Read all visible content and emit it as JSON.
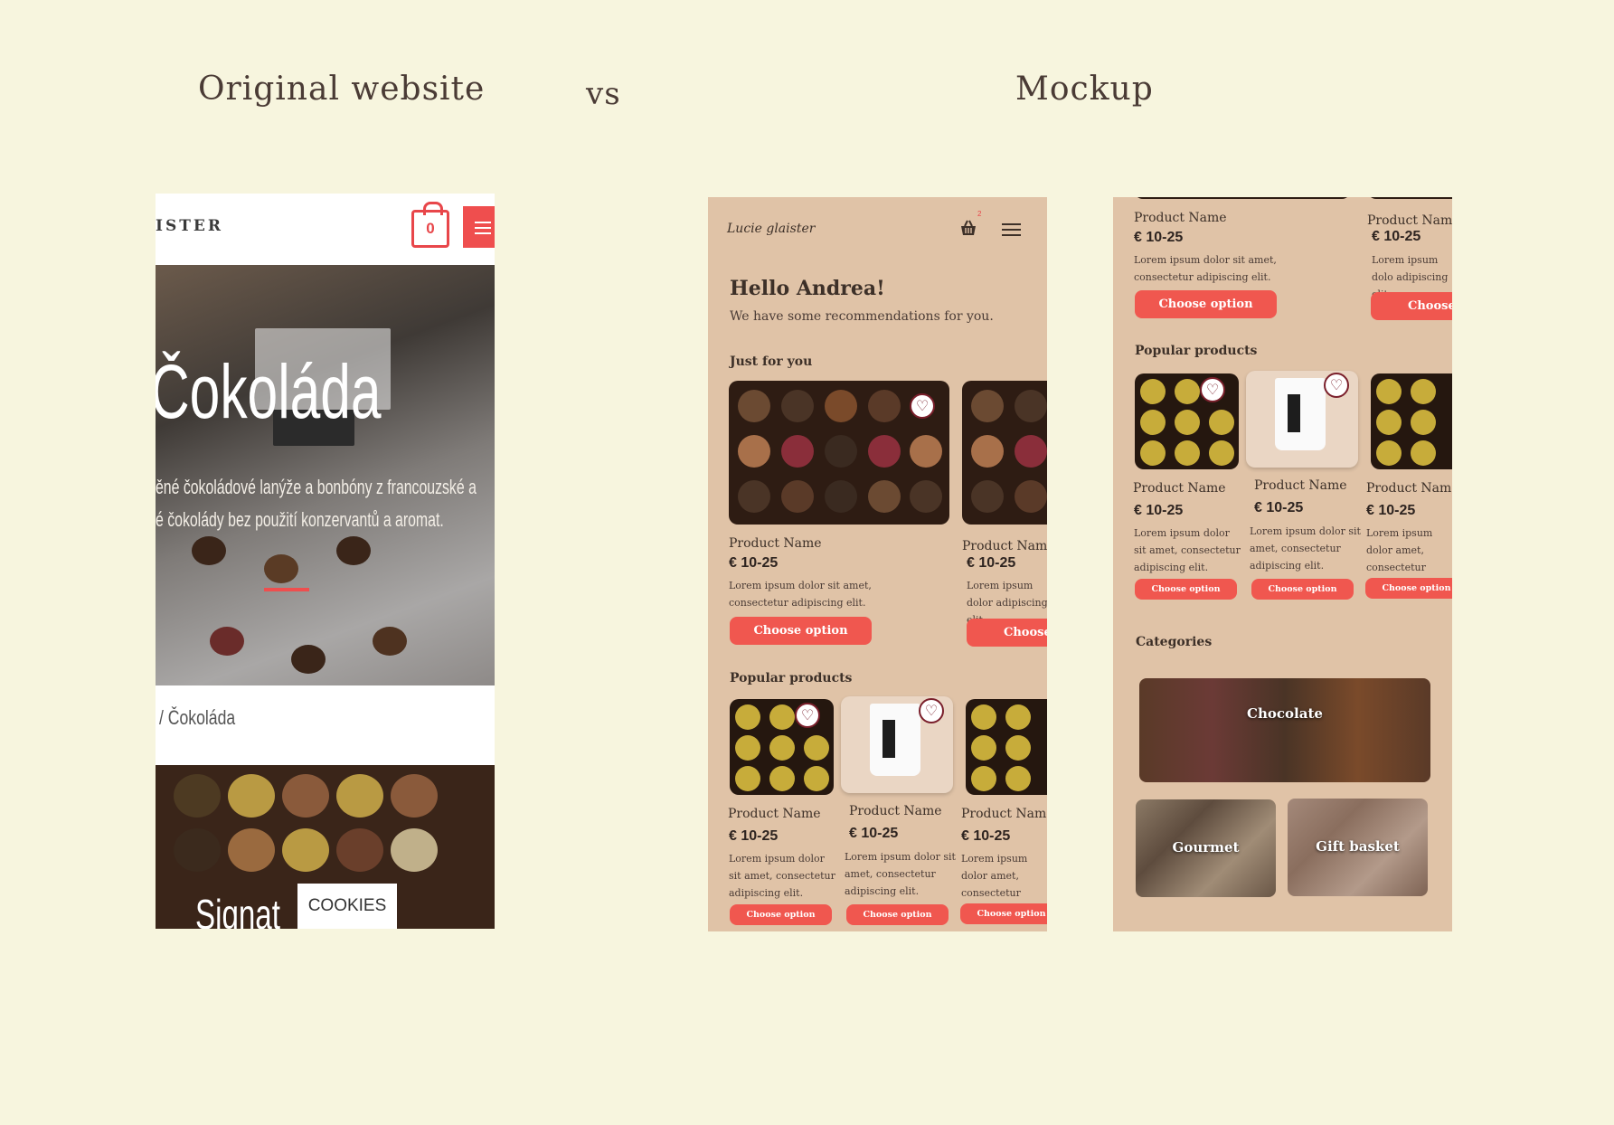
{
  "headings": {
    "original": "Original website",
    "vs": "vs",
    "mockup": "Mockup"
  },
  "original": {
    "brand": "ISTER",
    "cart_count": "0",
    "hero_title": "Čokoláda",
    "hero_line1": "ěné čokoládové lanýže a bonbóny z francouzské a",
    "hero_line2": "é čokolády bez použití konzervantů a aromat.",
    "breadcrumb": "/ Čokoláda",
    "bottom_text": "Signat",
    "cookies_label": "COOKIES"
  },
  "mockup1": {
    "logo": "Lucie glaister",
    "cart_count": "2",
    "greeting": "Hello Andrea!",
    "subtitle": "We have some recommendations for you.",
    "just_for_you_title": "Just for you",
    "just_for_you": [
      {
        "name": "Product Name",
        "price": "€ 10-25",
        "desc": "Lorem ipsum dolor sit amet, consectetur adipiscing elit.",
        "button": "Choose option"
      },
      {
        "name": "Product Name",
        "price": "€ 10-25",
        "desc": "Lorem ipsum dolor adipiscing elit.",
        "button": "Choose op"
      }
    ],
    "popular_title": "Popular products",
    "popular": [
      {
        "name": "Product Name",
        "price": "€ 10-25",
        "desc": "Lorem ipsum dolor sit amet, consectetur adipiscing elit.",
        "button": "Choose option"
      },
      {
        "name": "Product Name",
        "price": "€ 10-25",
        "desc": "Lorem ipsum dolor sit amet, consectetur adipiscing elit.",
        "button": "Choose option"
      },
      {
        "name": "Product Name",
        "price": "€ 10-25",
        "desc": "Lorem ipsum dolor amet, consectetur adipiscing elit.",
        "button": "Choose option"
      }
    ]
  },
  "mockup2": {
    "top_cards": [
      {
        "name": "Product Name",
        "price": "€ 10-25",
        "desc": "Lorem ipsum dolor sit amet, consectetur adipiscing elit.",
        "button": "Choose option"
      },
      {
        "name": "Product Name",
        "price": "€ 10-25",
        "desc": "Lorem ipsum dolo adipiscing elit.",
        "button": "Choose op"
      }
    ],
    "popular_title": "Popular products",
    "popular": [
      {
        "name": "Product Name",
        "price": "€ 10-25",
        "desc": "Lorem ipsum dolor sit amet, consectetur adipiscing elit.",
        "button": "Choose option"
      },
      {
        "name": "Product Name",
        "price": "€ 10-25",
        "desc": "Lorem ipsum dolor sit amet, consectetur adipiscing elit.",
        "button": "Choose option"
      },
      {
        "name": "Product Name",
        "price": "€ 10-25",
        "desc": "Lorem ipsum dolor amet, consectetur adipiscing elit.",
        "button": "Choose option"
      }
    ],
    "categories_title": "Categories",
    "categories": [
      "Chocolate",
      "Gourmet",
      "Gift basket"
    ]
  },
  "colors": {
    "page_bg": "#f7f5de",
    "mock_bg": "#e0c3a7",
    "accent": "#f0574f",
    "heart": "#7a1f2b",
    "text": "#3d3028"
  }
}
